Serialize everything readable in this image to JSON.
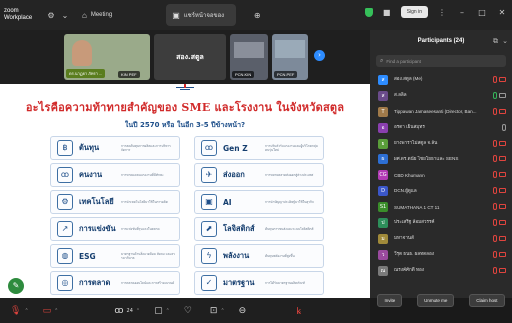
{
  "app": {
    "logo_line1": "zoom",
    "logo_line2": "Workplace"
  },
  "titlebar": {
    "tabs": [
      {
        "label": "Meeting",
        "icon": "home-icon"
      },
      {
        "label": "แชร์หน้าจอของ",
        "icon": "share-screen-icon"
      }
    ],
    "sign_in": "Sign in"
  },
  "videos": [
    {
      "name": "ดร.นาฏยา ภัทรา ...",
      "label2": "KIN PEF",
      "color": "#8a9a7a"
    },
    {
      "name": "สอง.สตูล",
      "label2": "",
      "color": "#3d3d3d"
    },
    {
      "name": "PCN.KIN",
      "label2": "",
      "color": "#5a5f6a"
    },
    {
      "name": "PCN.PEF",
      "label2": "",
      "color": "#7d8a9a"
    }
  ],
  "slide": {
    "title": "อะไรคือความท้าทายสำคัญของ SME และโรงงาน ในจังหวัดสตูล",
    "subtitle": "ในปี 2570 หรือ ในอีก 3-5 ปีข้างหน้า?",
    "cards": [
      {
        "label": "ต้นทุน",
        "icon": "coins-icon",
        "glyph": "฿",
        "desc": "การลดต้นทุนการผลิตและการบริหารจัดการ"
      },
      {
        "label": "Gen Z",
        "icon": "gen-z-icon",
        "glyph": "ꝏ",
        "desc": "การปรับตัวรับแรงงานและผู้บริโภคกลุ่มคนรุ่นใหม่"
      },
      {
        "label": "คนงาน",
        "icon": "workers-icon",
        "glyph": "ꝏ",
        "desc": "การขาดแคลนแรงงานที่มีทักษะ"
      },
      {
        "label": "ส่งออก",
        "icon": "export-icon",
        "glyph": "✈",
        "desc": "การขยายตลาดส่งออกสู่ต่างประเทศ"
      },
      {
        "label": "เทคโนโลยี",
        "icon": "technology-icon",
        "glyph": "⚙",
        "desc": "การนำเทคโนโลยีมาใช้ในการผลิต"
      },
      {
        "label": "AI",
        "icon": "ai-chip-icon",
        "glyph": "▣",
        "desc": "การนำปัญญาประดิษฐ์มาใช้ในธุรกิจ"
      },
      {
        "label": "การแข่งขัน",
        "icon": "competition-icon",
        "glyph": "↗",
        "desc": "การแข่งขันที่รุนแรงในตลาด"
      },
      {
        "label": "โลจิสติกส์",
        "icon": "logistics-icon",
        "glyph": "⬈",
        "desc": "ต้นทุนการขนส่งและระบบโลจิสติกส์"
      },
      {
        "label": "ESG",
        "icon": "globe-icon",
        "glyph": "◍",
        "desc": "มาตรฐานด้านสิ่งแวดล้อม สังคม และธรรมาภิบาล"
      },
      {
        "label": "พลังงาน",
        "icon": "energy-icon",
        "glyph": "ϟ",
        "desc": "ต้นทุนพลังงานที่สูงขึ้น"
      },
      {
        "label": "การตลาด",
        "icon": "marketing-icon",
        "glyph": "◎",
        "desc": "การตลาดออนไลน์และการสร้างแบรนด์"
      },
      {
        "label": "มาตรฐาน",
        "icon": "standard-icon",
        "glyph": "✓",
        "desc": "การได้รับมาตรฐานผลิตภัณฑ์"
      }
    ]
  },
  "participants": {
    "title": "Participants (24)",
    "search_placeholder": "Find a participant",
    "items": [
      {
        "name": "สอง.สตูล (Me)",
        "initial": "ส",
        "color": "#2d8cff",
        "mic": "muted",
        "cam": "off"
      },
      {
        "name": "ส.ลลิล",
        "initial": "ส",
        "color": "#6a4b8a",
        "mic": "on",
        "cam": "on"
      },
      {
        "name": "Tippawan Jamaseesanti (Director, Ban...",
        "initial": "T",
        "color": "#a07a4a",
        "mic": "muted",
        "cam": "off"
      },
      {
        "name": "อรดา เย็นสมุทร",
        "initial": "อ",
        "color": "#8a3fae",
        "mic": "off-gray",
        "cam": "none"
      },
      {
        "name": "ยางพาราไม่สตูล จ.ล้น",
        "initial": "ย",
        "color": "#5a9e3a",
        "mic": "muted",
        "cam": "off"
      },
      {
        "name": "ผศ.ดร.ดนัย ไชยโยธาและ SENS",
        "initial": "ผ",
        "color": "#2d6fd4",
        "mic": "muted",
        "cam": "off"
      },
      {
        "name": "CBD Khumann",
        "initial": "CG",
        "color": "#b23bb5",
        "mic": "muted",
        "cam": "off"
      },
      {
        "name": "DCN.ผู้ดูแล",
        "initial": "D",
        "color": "#3b57c9",
        "mic": "muted",
        "cam": "off"
      },
      {
        "name": "SUMATHANA 1 CT 11",
        "initial": "S1",
        "color": "#3a8e2a",
        "mic": "muted",
        "cam": "off"
      },
      {
        "name": "ประเสริฐ ล้อมสวรรค์",
        "initial": "ป",
        "color": "#2d8f5a",
        "mic": "muted",
        "cam": "off"
      },
      {
        "name": "มหาจานส์",
        "initial": "ม",
        "color": "#a08a3a",
        "mic": "muted",
        "cam": "off"
      },
      {
        "name": "วีรุต ธนธ. ผลทดลอง",
        "initial": "ว",
        "color": "#9a4a9e",
        "mic": "muted",
        "cam": "off"
      },
      {
        "name": "ณรงค์ศักดิ์ ทอง",
        "initial": "ณ",
        "color": "#7a7a7a",
        "mic": "muted",
        "cam": "off"
      }
    ],
    "footer": {
      "invite": "Invite",
      "unmute_me": "Unmute me",
      "claim_host": "Claim host"
    }
  },
  "toolbar": {
    "participant_count": "24"
  }
}
